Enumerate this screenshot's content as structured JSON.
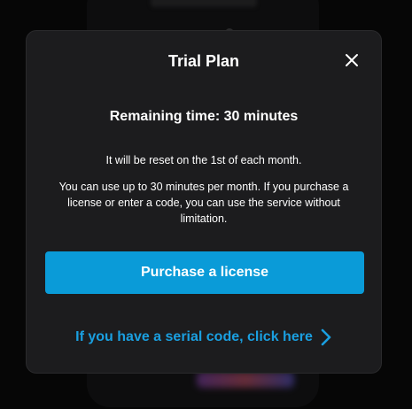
{
  "dialog": {
    "title": "Trial Plan",
    "remaining_time": "Remaining time: 30 minutes",
    "reset_note": "It will be reset on the 1st of each month.",
    "usage_note": "You can use up to 30 minutes per month. If you purchase a license or enter a code, you can use the service without limitation.",
    "purchase_button": "Purchase a license",
    "serial_link": "If you have a serial code, click here"
  },
  "icons": {
    "close": "close-icon",
    "serial_link_chevron": "chevron-right-icon"
  },
  "colors": {
    "dialog_background": "#1c1c1e",
    "accent": "#0a9bd8",
    "link": "#1a9fe0",
    "text": "#ffffff"
  }
}
